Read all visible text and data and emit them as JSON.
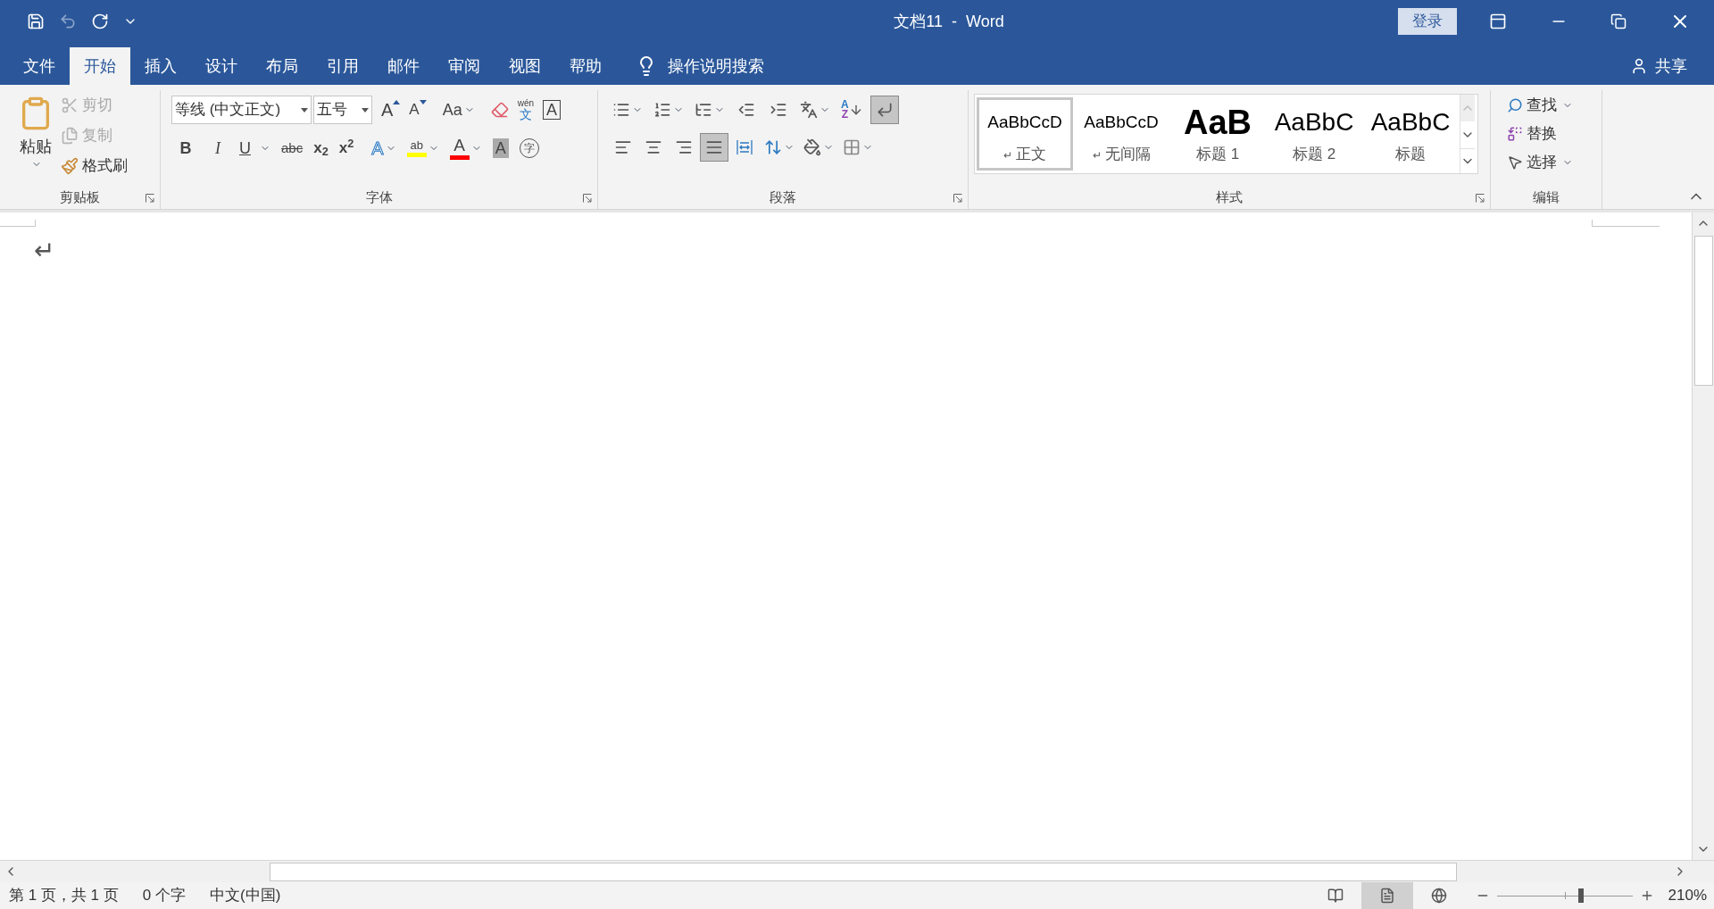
{
  "title_bar": {
    "title": "文档11  -  Word",
    "login": "登录"
  },
  "tabs": [
    {
      "label": "文件",
      "selected": false
    },
    {
      "label": "开始",
      "selected": true
    },
    {
      "label": "插入",
      "selected": false
    },
    {
      "label": "设计",
      "selected": false
    },
    {
      "label": "布局",
      "selected": false
    },
    {
      "label": "引用",
      "selected": false
    },
    {
      "label": "邮件",
      "selected": false
    },
    {
      "label": "审阅",
      "selected": false
    },
    {
      "label": "视图",
      "selected": false
    },
    {
      "label": "帮助",
      "selected": false
    }
  ],
  "tell_me": "操作说明搜索",
  "share": "共享",
  "clipboard": {
    "label": "剪贴板",
    "paste": "粘贴",
    "items": [
      {
        "kind": "cut",
        "label": "剪切",
        "disabled": true
      },
      {
        "kind": "copy",
        "label": "复制",
        "disabled": true
      },
      {
        "kind": "painter",
        "label": "格式刷",
        "disabled": false
      }
    ]
  },
  "font": {
    "label": "字体",
    "font_name": "等线 (中文正文)",
    "font_size": "五号",
    "row1": [
      {
        "kind": "grow",
        "glyph": "A"
      },
      {
        "kind": "shrink",
        "glyph": "A"
      },
      {
        "kind": "case",
        "glyph": "Aa"
      },
      {
        "kind": "clear"
      },
      {
        "kind": "phonetic",
        "glyph": "wén",
        "glyph2": "文"
      },
      {
        "kind": "border",
        "glyph": "A"
      }
    ],
    "row2": [
      {
        "kind": "bold",
        "glyph": "B"
      },
      {
        "kind": "italic",
        "glyph": "I"
      },
      {
        "kind": "underline",
        "glyph": "U"
      },
      {
        "kind": "strike",
        "glyph": "abc"
      },
      {
        "kind": "sub",
        "glyph": "x$_{2}$"
      },
      {
        "kind": "sup",
        "glyph": "x$^{2}$"
      },
      {
        "kind": "effects",
        "glyph": "A"
      },
      {
        "kind": "highlight",
        "glyph": "ab",
        "color": "#ffff00"
      },
      {
        "kind": "fontcolor",
        "glyph": "A",
        "color": "#ff0000"
      },
      {
        "kind": "shading",
        "glyph": "A"
      },
      {
        "kind": "enclose",
        "glyph": "字"
      }
    ]
  },
  "paragraph": {
    "label": "段落",
    "row1": [
      {
        "kind": "bullets"
      },
      {
        "kind": "numbering"
      },
      {
        "kind": "multilevel"
      },
      {
        "kind": "outdent"
      },
      {
        "kind": "indent"
      },
      {
        "kind": "asian"
      },
      {
        "kind": "sort",
        "glyph": "A",
        "glyph2": "Z"
      },
      {
        "kind": "marks",
        "on": true
      }
    ],
    "row2": [
      {
        "kind": "left",
        "selected": false
      },
      {
        "kind": "center",
        "selected": false
      },
      {
        "kind": "right",
        "selected": false
      },
      {
        "kind": "justify",
        "selected": true
      },
      {
        "kind": "distributed",
        "selected": false
      },
      {
        "kind": "spacing"
      },
      {
        "kind": "fill"
      },
      {
        "kind": "borders"
      }
    ]
  },
  "styles": {
    "label": "样式",
    "items": [
      {
        "preview": "AaBbCcD",
        "mark": "↵",
        "name": "正文",
        "kind": "normal",
        "selected": true
      },
      {
        "preview": "AaBbCcD",
        "mark": "↵",
        "name": "无间隔",
        "kind": "normal",
        "selected": false
      },
      {
        "preview": "AaB",
        "name": "标题 1",
        "kind": "heading1",
        "selected": false
      },
      {
        "preview": "AaBbC",
        "name": "标题 2",
        "kind": "heading2",
        "selected": false
      },
      {
        "preview": "AaBbC",
        "name": "标题",
        "kind": "title",
        "selected": false
      }
    ]
  },
  "editing": {
    "label": "编辑",
    "items": [
      {
        "kind": "find",
        "label": "查找"
      },
      {
        "kind": "replace",
        "label": "替换"
      },
      {
        "kind": "select",
        "label": "选择"
      }
    ]
  },
  "document": {
    "paragraph_mark": "↵"
  },
  "status_bar": {
    "page": "第 1 页，共 1 页",
    "words": "0 个字",
    "language": "中文(中国)",
    "views": [
      {
        "kind": "read",
        "selected": false
      },
      {
        "kind": "print",
        "selected": true
      },
      {
        "kind": "web",
        "selected": false
      }
    ],
    "zoom": {
      "level": 0.62,
      "reading": "210%"
    }
  }
}
